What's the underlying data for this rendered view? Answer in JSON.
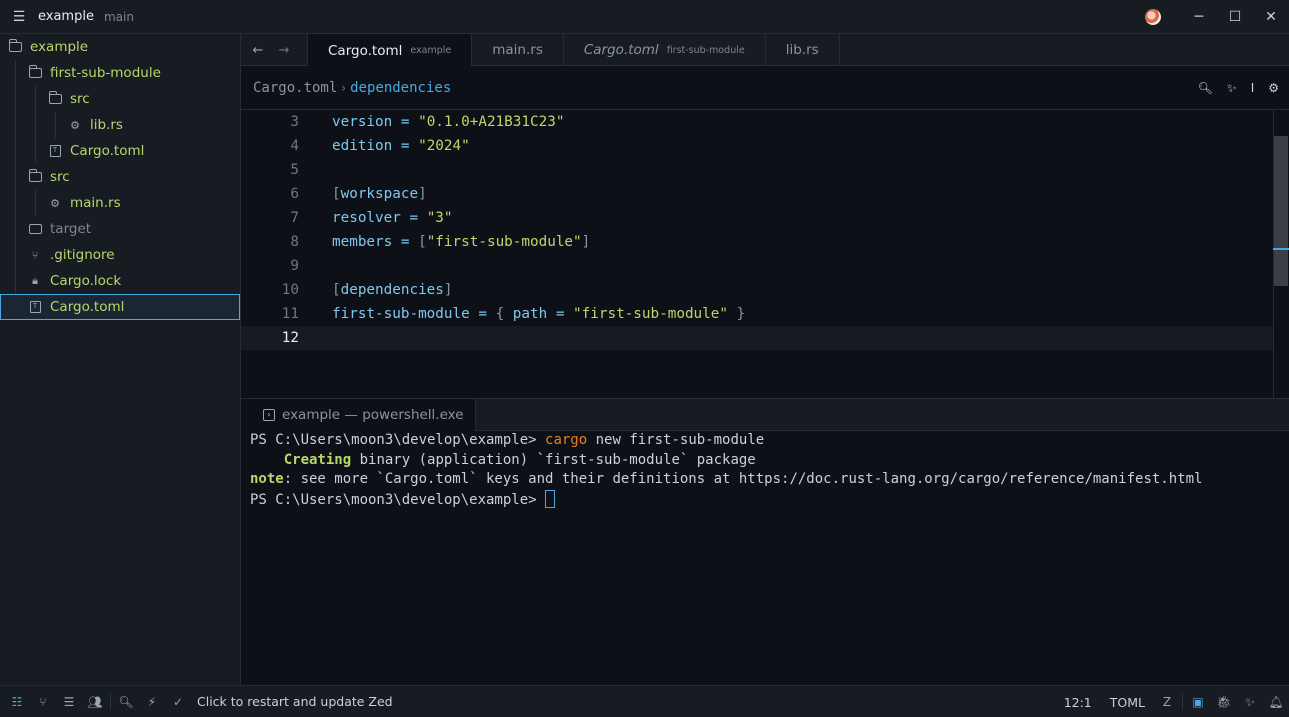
{
  "titlebar": {
    "project": "example",
    "branch": "main"
  },
  "sidebar": {
    "items": [
      {
        "label": "example"
      },
      {
        "label": "first-sub-module"
      },
      {
        "label": "src"
      },
      {
        "label": "lib.rs"
      },
      {
        "label": "Cargo.toml"
      },
      {
        "label": "src"
      },
      {
        "label": "main.rs"
      },
      {
        "label": "target"
      },
      {
        "label": ".gitignore"
      },
      {
        "label": "Cargo.lock"
      },
      {
        "label": "Cargo.toml"
      }
    ]
  },
  "tabs": [
    {
      "label": "Cargo.toml",
      "hint": "example"
    },
    {
      "label": "main.rs",
      "hint": ""
    },
    {
      "label": "Cargo.toml",
      "hint": "first-sub-module"
    },
    {
      "label": "lib.rs",
      "hint": ""
    }
  ],
  "breadcrumb": {
    "file": "Cargo.toml",
    "separator": "›",
    "section": "dependencies"
  },
  "code": {
    "line_numbers": [
      "3",
      "4",
      "5",
      "6",
      "7",
      "8",
      "9",
      "10",
      "11",
      "12"
    ],
    "l3": {
      "key": "version",
      "eq": " = ",
      "val": "\"0.1.0+A21B31C23\""
    },
    "l4": {
      "key": "edition",
      "eq": " = ",
      "val": "\"2024\""
    },
    "l6": {
      "open": "[",
      "name": "workspace",
      "close": "]"
    },
    "l7": {
      "key": "resolver",
      "eq": " = ",
      "val": "\"3\""
    },
    "l8": {
      "key": "members",
      "eq": " = ",
      "open": "[",
      "val": "\"first-sub-module\"",
      "close": "]"
    },
    "l10": {
      "open": "[",
      "name": "dependencies",
      "close": "]"
    },
    "l11": {
      "key": "first-sub-module",
      "eq": " = ",
      "open": "{ ",
      "key2": "path",
      "eq2": " = ",
      "val": "\"first-sub-module\"",
      "close": " }"
    }
  },
  "terminal": {
    "tab_label": "example — powershell.exe",
    "line1_prompt": "PS C:\\Users\\moon3\\develop\\example> ",
    "line1_cmd": "cargo",
    "line1_rest": " new first-sub-module",
    "line2_indent": "    ",
    "line2_green": "Creating",
    "line2_rest": " binary (application) `first-sub-module` package",
    "line3_green": "note",
    "line3_rest": ": see more `Cargo.toml` keys and their definitions at https://doc.rust-lang.org/cargo/reference/manifest.html",
    "line4_prompt": "PS C:\\Users\\moon3\\develop\\example> "
  },
  "statusbar": {
    "message": "Click to restart and update Zed",
    "cursor_pos": "12:1",
    "language": "TOML"
  },
  "colors": {
    "accent": "#4aa8e0",
    "file_green": "#b8d86a",
    "cargo_orange": "#e67e22"
  }
}
